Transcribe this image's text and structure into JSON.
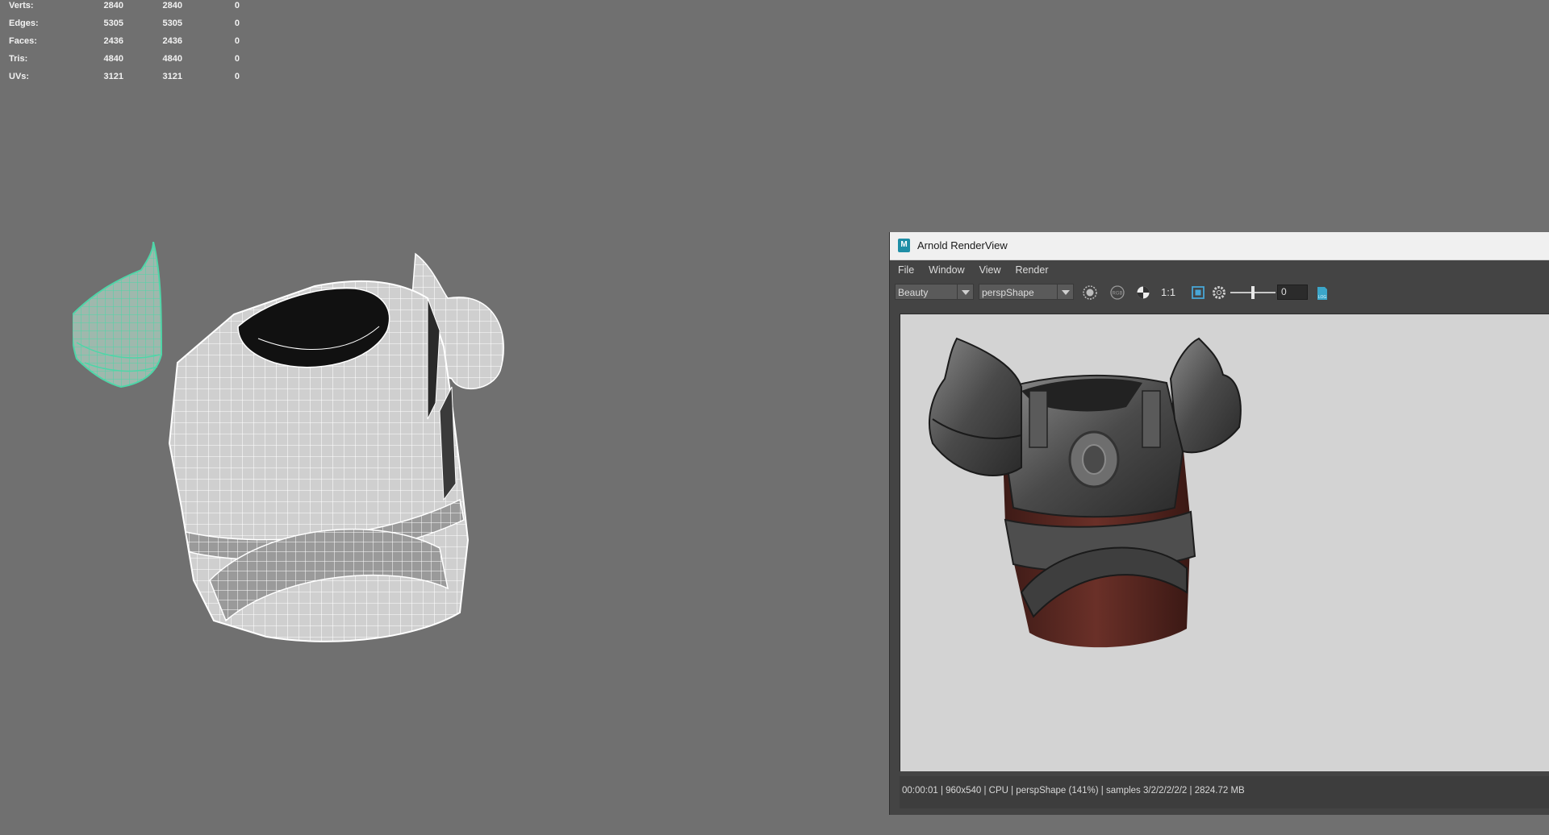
{
  "hud": {
    "rows": [
      {
        "label": "Verts:",
        "c1": "2840",
        "c2": "2840",
        "c3": "0"
      },
      {
        "label": "Edges:",
        "c1": "5305",
        "c2": "5305",
        "c3": "0"
      },
      {
        "label": "Faces:",
        "c1": "2436",
        "c2": "2436",
        "c3": "0"
      },
      {
        "label": "Tris:",
        "c1": "4840",
        "c2": "4840",
        "c3": "0"
      },
      {
        "label": "UVs:",
        "c1": "3121",
        "c2": "3121",
        "c3": "0"
      }
    ]
  },
  "viewport": {
    "selection_color": "#4fd6a8",
    "wire_color": "#ffffff"
  },
  "render_view": {
    "app_icon_text": "M",
    "title": "Arnold RenderView",
    "menus": [
      "File",
      "Window",
      "View",
      "Render"
    ],
    "aov_select": "Beauty",
    "camera_select": "perspShape",
    "ratio_label": "1:1",
    "exposure_value": "0",
    "status": "00:00:01 | 960x540 | CPU | perspShape (141%) | samples 3/2/2/2/2/2 | 2824.72 MB",
    "icons": [
      "render-sphere-icon",
      "rgb-channel-icon",
      "contrast-icon",
      "region-icon",
      "settings-gear-icon",
      "log-icon"
    ],
    "armor_colors": {
      "metal": "#5a5a5a",
      "leather": "#5a2a22"
    }
  }
}
